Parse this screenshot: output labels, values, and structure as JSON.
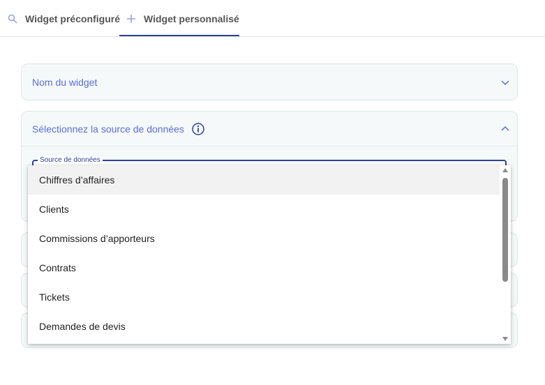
{
  "tabs": [
    {
      "label": "Widget préconfiguré",
      "icon": "search-icon"
    },
    {
      "label": "Widget personnalisé",
      "icon": "plus-icon",
      "active": true
    }
  ],
  "panels": {
    "name": {
      "title": "Nom du widget",
      "icon": "chevron-down-icon"
    },
    "source": {
      "title": "Sélectionnez la source de données",
      "info_icon": "info-icon",
      "icon": "chevron-up-icon"
    }
  },
  "source_field": {
    "label": "Source de données"
  },
  "dropdown": {
    "options": [
      "Chiffres d’affaires",
      "Clients",
      "Commissions d’apporteurs",
      "Contrats",
      "Tickets",
      "Demandes de devis"
    ],
    "highlighted_index": 0
  },
  "colors": {
    "accent": "#2e3f99",
    "panel_title": "#5a6ed6",
    "panel_bg": "#f5f9f9"
  }
}
